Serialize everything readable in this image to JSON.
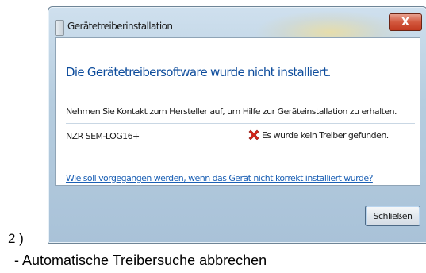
{
  "window": {
    "title": "Gerätetreiberinstallation",
    "close_glyph": "X",
    "heading": "Die Gerätetreibersoftware wurde nicht installiert.",
    "instruction": "Nehmen Sie Kontakt zum Hersteller auf, um Hilfe zur Geräteinstallation zu erhalten.",
    "device": {
      "name": "NZR SEM-LOG16+",
      "status": "Es wurde kein Treiber gefunden.",
      "status_icon": "red-x-icon"
    },
    "help_link": "Wie soll vorgegangen werden, wenn das Gerät nicht korrekt installiert wurde?",
    "close_button_label": "Schließen"
  },
  "document": {
    "step_label": "2 )",
    "caption": "- Automatische Treibersuche abbrechen"
  },
  "colors": {
    "heading": "#0d4c9c",
    "link": "#1a5fb4",
    "error_icon": "#d6261a",
    "close_button": "#c23a20"
  }
}
